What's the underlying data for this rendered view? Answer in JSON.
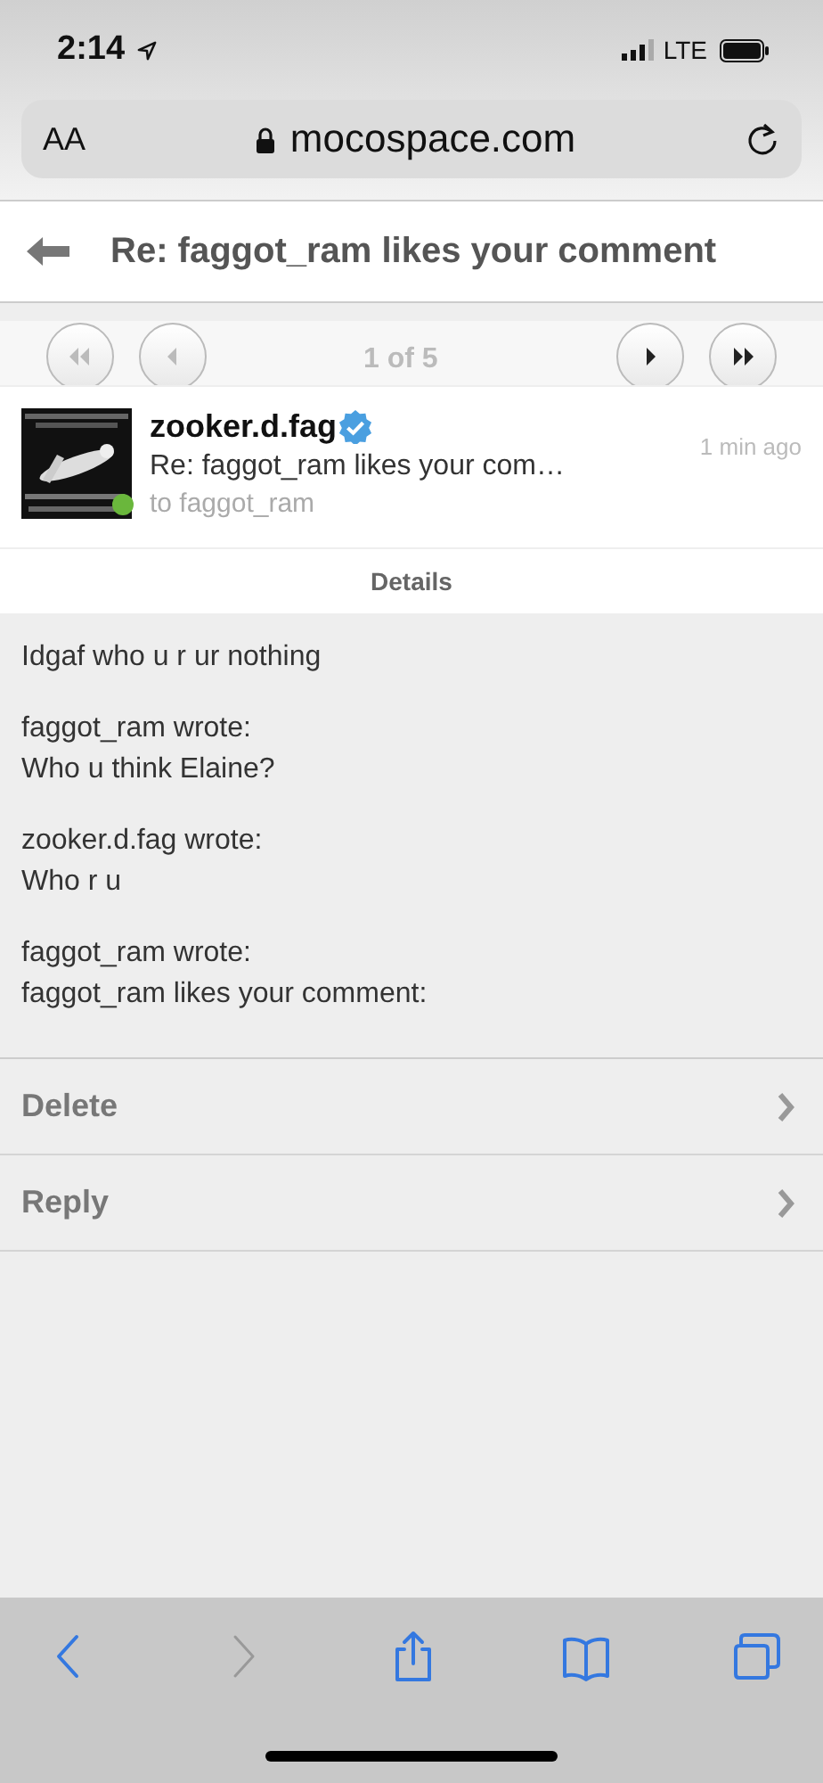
{
  "status_bar": {
    "time": "2:14",
    "network": "LTE"
  },
  "address_bar": {
    "text_size_label": "AA",
    "url": "mocospace.com"
  },
  "header": {
    "title": "Re: faggot_ram likes your comment"
  },
  "pager": {
    "counter": "1 of 5",
    "buttons": [
      {
        "kind": "first",
        "disabled": true
      },
      {
        "kind": "prev",
        "disabled": true
      },
      {
        "kind": "next",
        "disabled": false
      },
      {
        "kind": "last",
        "disabled": false
      }
    ]
  },
  "message": {
    "sender": "zooker.d.fag",
    "verified": true,
    "online": true,
    "subject": "Re: faggot_ram likes your com…",
    "recipient": "to faggot_ram",
    "time": "1 min ago"
  },
  "details_label": "Details",
  "body": [
    [
      "Idgaf who u r ur nothing"
    ],
    [
      "faggot_ram wrote:",
      "Who u think Elaine?"
    ],
    [
      "zooker.d.fag wrote:",
      "Who r u"
    ],
    [
      "faggot_ram wrote:",
      "faggot_ram likes your comment:"
    ]
  ],
  "actions": [
    {
      "label": "Delete"
    },
    {
      "label": "Reply"
    }
  ],
  "toolbar": [
    {
      "kind": "back",
      "disabled": false
    },
    {
      "kind": "forward",
      "disabled": true
    },
    {
      "kind": "share",
      "disabled": false
    },
    {
      "kind": "bookmarks",
      "disabled": false
    },
    {
      "kind": "tabs",
      "disabled": false
    }
  ]
}
